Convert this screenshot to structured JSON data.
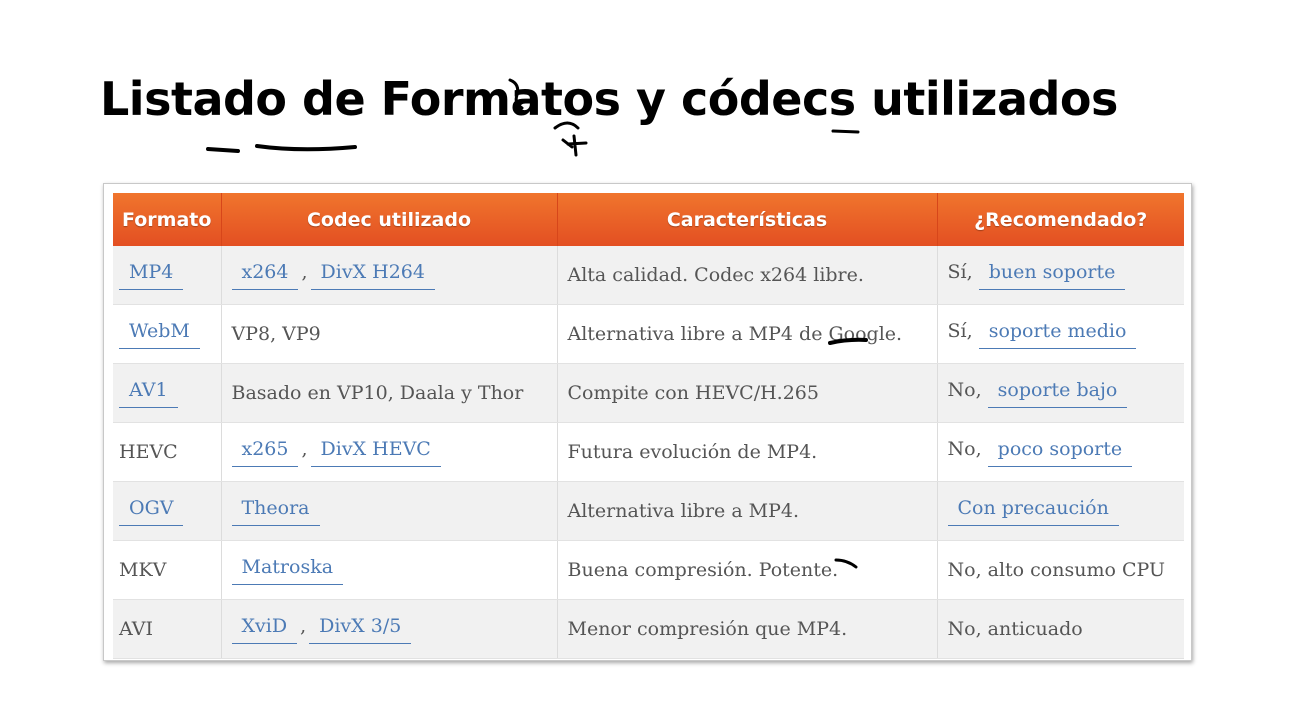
{
  "title": "Listado de Formatos y códecs utilizados",
  "table": {
    "headers": [
      "Formato",
      "Codec utilizado",
      "Características",
      "¿Recomendado?"
    ],
    "rows": [
      {
        "format": "MP4",
        "codec1": "x264",
        "codec2": "DivX H264",
        "features": "Alta calidad. Codec x264 libre.",
        "rec_prefix": "Sí,",
        "rec_link": "buen soporte"
      },
      {
        "format": "WebM",
        "codec_text": "VP8, VP9",
        "features": "Alternativa libre a MP4 de Google.",
        "rec_prefix": "Sí,",
        "rec_link": "soporte medio"
      },
      {
        "format": "AV1",
        "codec_text": "Basado en VP10, Daala y Thor",
        "features": "Compite con HEVC/H.265",
        "rec_prefix": "No,",
        "rec_link": "soporte bajo"
      },
      {
        "format": "HEVC",
        "codec1": "x265",
        "codec2": "DivX HEVC",
        "features": "Futura evolución de MP4.",
        "rec_prefix": "No,",
        "rec_link": "poco soporte"
      },
      {
        "format": "OGV",
        "codec1": "Theora",
        "features": "Alternativa libre a MP4.",
        "rec_link": "Con precaución"
      },
      {
        "format": "MKV",
        "codec1": "Matroska",
        "features": "Buena compresión. Potente.",
        "rec_text": "No, alto consumo CPU"
      },
      {
        "format": "AVI",
        "codec1": "XviD",
        "codec2": "DivX 3/5",
        "features": "Menor compresión que MP4.",
        "rec_text": "No, anticuado"
      }
    ]
  },
  "colors": {
    "header_orange": "#e85a26",
    "link_blue": "#4c7ab5",
    "row_stripe": "#f1f1f1",
    "annotation_ink": "#000000"
  }
}
